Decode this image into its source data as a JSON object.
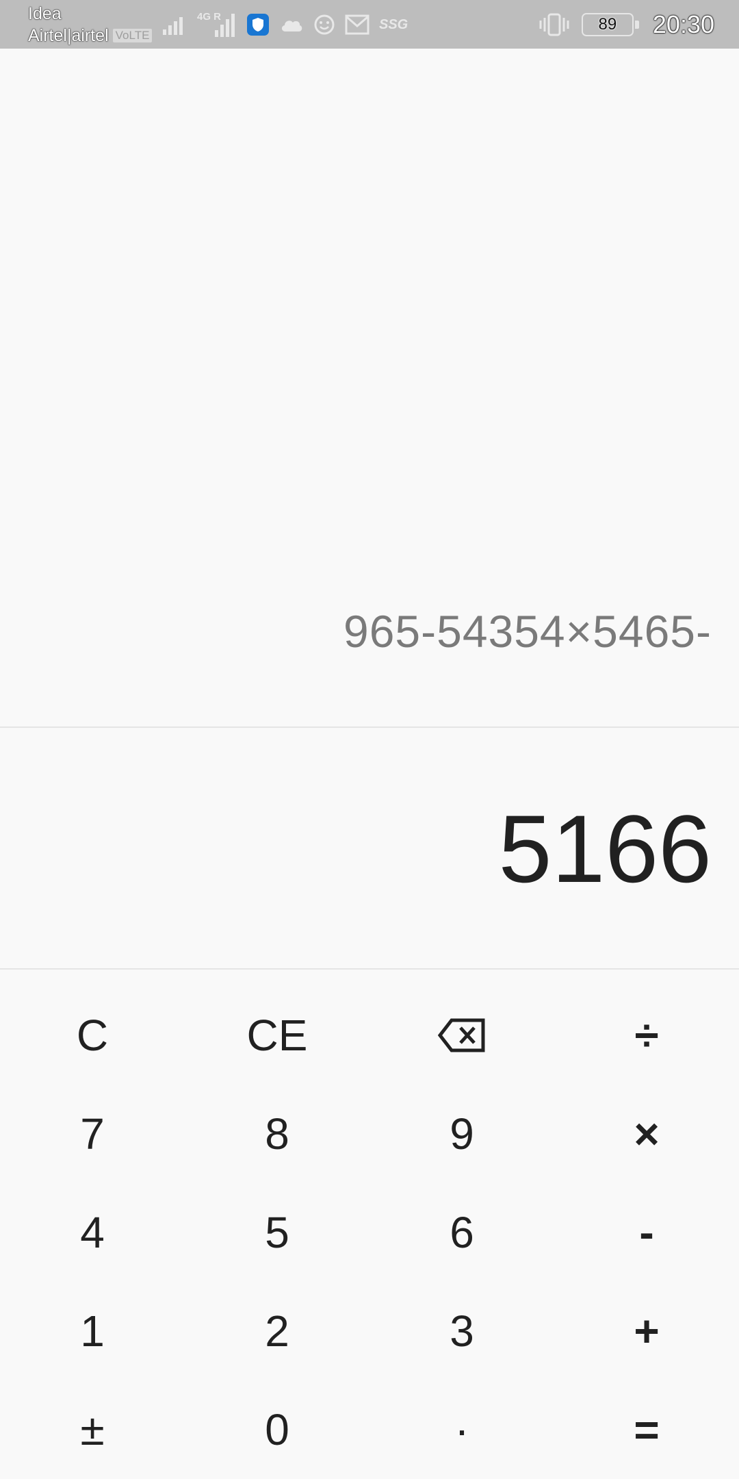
{
  "status_bar": {
    "carrier_line1": "Idea",
    "carrier_line2": "Airtel|airtel",
    "volte": "VoLTE",
    "network_type": "4G R",
    "ssg_label": "SSG",
    "battery_level": "89",
    "time": "20:30",
    "icons": [
      "signal-icon",
      "signal-4g-icon",
      "shield-app-icon",
      "cloud-icon",
      "smiley-icon",
      "mail-icon",
      "ssg-icon",
      "vibrate-icon",
      "battery-icon"
    ]
  },
  "display": {
    "expression": "965-54354×5465-",
    "result": "5166"
  },
  "keypad": {
    "rows": [
      [
        {
          "label": "C",
          "name": "clear-button"
        },
        {
          "label": "CE",
          "name": "clear-entry-button"
        },
        {
          "label": "",
          "name": "backspace-button"
        },
        {
          "label": "÷",
          "name": "divide-button"
        }
      ],
      [
        {
          "label": "7",
          "name": "digit-7-button"
        },
        {
          "label": "8",
          "name": "digit-8-button"
        },
        {
          "label": "9",
          "name": "digit-9-button"
        },
        {
          "label": "×",
          "name": "multiply-button"
        }
      ],
      [
        {
          "label": "4",
          "name": "digit-4-button"
        },
        {
          "label": "5",
          "name": "digit-5-button"
        },
        {
          "label": "6",
          "name": "digit-6-button"
        },
        {
          "label": "-",
          "name": "subtract-button"
        }
      ],
      [
        {
          "label": "1",
          "name": "digit-1-button"
        },
        {
          "label": "2",
          "name": "digit-2-button"
        },
        {
          "label": "3",
          "name": "digit-3-button"
        },
        {
          "label": "+",
          "name": "add-button"
        }
      ],
      [
        {
          "label": "±",
          "name": "plus-minus-button"
        },
        {
          "label": "0",
          "name": "digit-0-button"
        },
        {
          "label": "·",
          "name": "decimal-point-button"
        },
        {
          "label": "=",
          "name": "equals-button"
        }
      ]
    ]
  },
  "colors": {
    "status_bar_bg": "#bdbdbd",
    "background": "#f9f9f9",
    "expression_text": "#7a7a7a",
    "result_text": "#212121"
  }
}
